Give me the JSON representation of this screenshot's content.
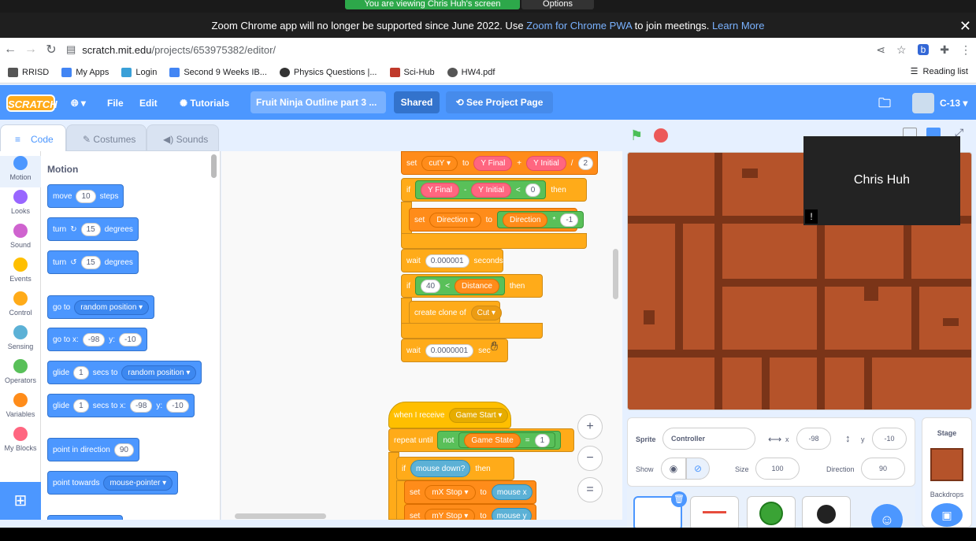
{
  "share": {
    "viewing": "You are viewing Chris Huh's screen",
    "options": "Options"
  },
  "zoom_notice": {
    "text": "Zoom Chrome app will no longer be supported since June 2022. Use ",
    "link": "Zoom for Chrome PWA",
    "text2": " to join meetings. ",
    "learn": "Learn More"
  },
  "browser": {
    "url_host": "scratch.mit.edu",
    "url_path": "/projects/653975382/editor/"
  },
  "bookmarks": [
    "RRISD",
    "My Apps",
    "Login",
    "Second 9 Weeks IB...",
    "Physics Questions |...",
    "Sci-Hub",
    "HW4.pdf"
  ],
  "reading_list": "Reading list",
  "menubar": {
    "logo": "SCRATCH",
    "file": "File",
    "edit": "Edit",
    "tutorials": "Tutorials",
    "project_title": "Fruit Ninja Outline part 3 ...",
    "shared": "Shared",
    "see_project": "See Project Page",
    "user": "C-13"
  },
  "tabs": {
    "code": "Code",
    "costumes": "Costumes",
    "sounds": "Sounds"
  },
  "categories": [
    {
      "label": "Motion",
      "color": "#4c97ff"
    },
    {
      "label": "Looks",
      "color": "#9966ff"
    },
    {
      "label": "Sound",
      "color": "#cf63cf"
    },
    {
      "label": "Events",
      "color": "#ffbf00"
    },
    {
      "label": "Control",
      "color": "#ffab19"
    },
    {
      "label": "Sensing",
      "color": "#5cb1d6"
    },
    {
      "label": "Operators",
      "color": "#59c059"
    },
    {
      "label": "Variables",
      "color": "#ff8c1a"
    },
    {
      "label": "My Blocks",
      "color": "#ff6680"
    }
  ],
  "palette": {
    "title": "Motion",
    "move": {
      "a": "move",
      "v": "10",
      "b": "steps"
    },
    "turn_cw": {
      "a": "turn",
      "v": "15",
      "b": "degrees"
    },
    "turn_ccw": {
      "a": "turn",
      "v": "15",
      "b": "degrees"
    },
    "goto": {
      "a": "go to",
      "dd": "random position"
    },
    "gotoxy": {
      "a": "go to x:",
      "x": "-98",
      "b": "y:",
      "y": "-10"
    },
    "glide_rand": {
      "a": "glide",
      "v": "1",
      "b": "secs to",
      "dd": "random position"
    },
    "glide_xy": {
      "a": "glide",
      "v": "1",
      "b": "secs to x:",
      "x": "-98",
      "c": "y:",
      "y": "-10"
    },
    "point_dir": {
      "a": "point in direction",
      "v": "90"
    },
    "point_towards": {
      "a": "point towards",
      "dd": "mouse-pointer"
    }
  },
  "script": {
    "set_cuty": {
      "a": "set",
      "dd": "cutY",
      "b": "to",
      "p1": "Y Final",
      "op": "+",
      "p2": "Y Initial",
      "op2": "/",
      "v": "2"
    },
    "if1": {
      "a": "if",
      "p1": "Y Final",
      "op": "-",
      "p2": "Y Initial",
      "cmp": "<",
      "v": "0",
      "b": "then"
    },
    "set_dir": {
      "a": "set",
      "dd": "Direction",
      "b": "to",
      "p1": "Direction",
      "op": "*",
      "v": "-1"
    },
    "wait1": {
      "a": "wait",
      "v": "0.000001",
      "b": "seconds"
    },
    "if2": {
      "a": "if",
      "v": "40",
      "cmp": "<",
      "p1": "Distance",
      "b": "then"
    },
    "clone": {
      "a": "create clone of",
      "dd": "Cut"
    },
    "wait2": {
      "a": "wait",
      "v": "0.0000001",
      "b": "sec"
    },
    "hat": {
      "a": "when I receive",
      "dd": "Game Start"
    },
    "repeat": {
      "a": "repeat until",
      "b": "not",
      "p1": "Game State",
      "op": "=",
      "v": "1"
    },
    "if3": {
      "a": "if",
      "p1": "mouse down?",
      "b": "then"
    },
    "set_mx": {
      "a": "set",
      "dd": "mX Stop",
      "b": "to",
      "p1": "mouse x"
    },
    "set_my": {
      "a": "set",
      "dd": "mY Stop",
      "b": "to",
      "p1": "mouse y"
    }
  },
  "zoom_controls": {
    "in": "+",
    "out": "−",
    "reset": "="
  },
  "video": {
    "name": "Chris Huh"
  },
  "sprite_info": {
    "sprite_label": "Sprite",
    "sprite_name": "Controller",
    "x_label": "x",
    "x": "-98",
    "y_label": "y",
    "y": "-10",
    "show_label": "Show",
    "size_label": "Size",
    "size": "100",
    "direction_label": "Direction",
    "direction": "90"
  },
  "stage_panel": {
    "title": "Stage",
    "backdrops": "Backdrops"
  }
}
